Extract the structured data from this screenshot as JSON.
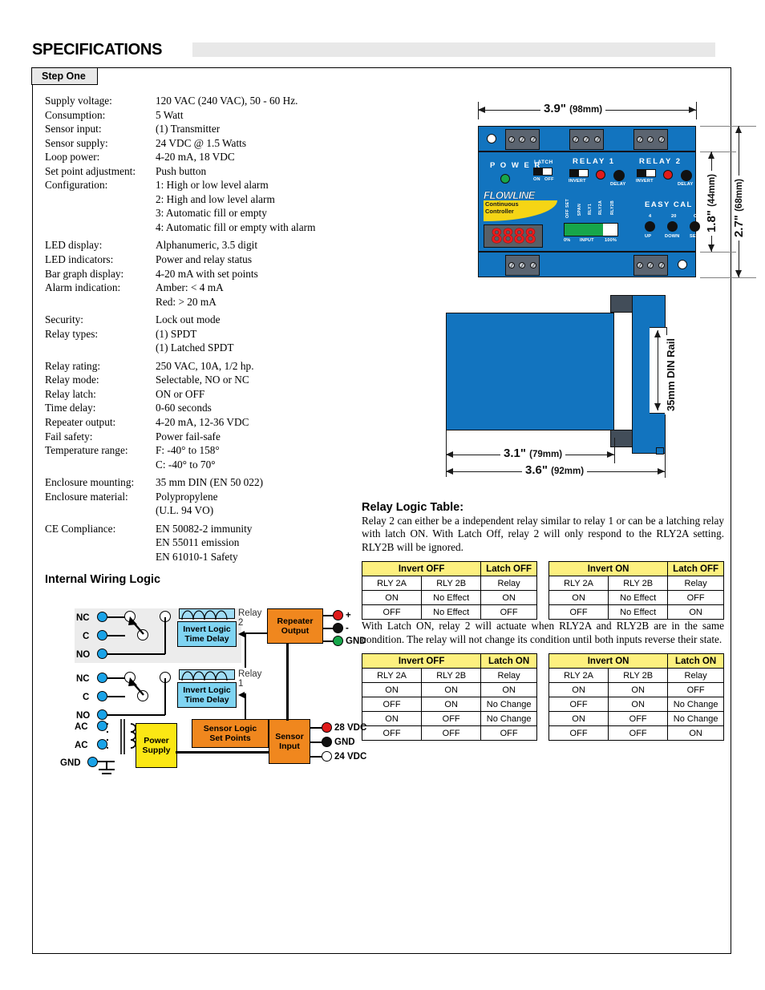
{
  "header": {
    "title": "SPECIFICATIONS",
    "step_badge": "Step One"
  },
  "specifications": [
    {
      "label": "Supply voltage:",
      "value": "120 VAC (240 VAC), 50 - 60 Hz."
    },
    {
      "label": "Consumption:",
      "value": "5 Watt"
    },
    {
      "label": "Sensor input:",
      "value": "(1) Transmitter"
    },
    {
      "label": "Sensor supply:",
      "value": "24 VDC @ 1.5 Watts"
    },
    {
      "label": "Loop power:",
      "value": "4-20 mA, 18 VDC"
    },
    {
      "label": "Set point adjustment:",
      "value": "Push button"
    },
    {
      "label": "Configuration:",
      "value": "1: High or low level alarm"
    },
    {
      "label": "",
      "value": "2: High and low level alarm"
    },
    {
      "label": "",
      "value": "3: Automatic fill or empty"
    },
    {
      "label": "",
      "value": "4: Automatic fill or empty with alarm"
    },
    {
      "label": "LED display:",
      "value": "Alphanumeric, 3.5 digit"
    },
    {
      "label": "LED indicators:",
      "value": "Power and relay status"
    },
    {
      "label": "Bar graph display:",
      "value": "4-20 mA with set points"
    },
    {
      "label": "Alarm indication:",
      "value": "Amber: < 4 mA"
    },
    {
      "label": "",
      "value": "Red: > 20 mA"
    },
    {
      "label": "Security:",
      "value": "Lock out mode"
    },
    {
      "label": "Relay types:",
      "value": "(1) SPDT"
    },
    {
      "label": "",
      "value": "(1) Latched SPDT"
    },
    {
      "label": "Relay rating:",
      "value": "250 VAC, 10A, 1/2 hp."
    },
    {
      "label": "Relay mode:",
      "value": "Selectable, NO or NC"
    },
    {
      "label": "Relay latch:",
      "value": "ON or OFF"
    },
    {
      "label": "Time delay:",
      "value": "0-60 seconds"
    },
    {
      "label": "Repeater output:",
      "value": "4-20 mA, 12-36 VDC"
    },
    {
      "label": "Fail safety:",
      "value": "Power fail-safe"
    },
    {
      "label": "Temperature range:",
      "value": "F: -40° to 158°"
    },
    {
      "label": "",
      "value": "C: -40° to 70°"
    },
    {
      "label": "Enclosure mounting:",
      "value": "35 mm DIN (EN 50 022)"
    },
    {
      "label": "Enclosure material:",
      "value": "Polypropylene"
    },
    {
      "label": "",
      "value": "(U.L. 94 VO)"
    },
    {
      "label": "CE Compliance:",
      "value": "EN 50082-2 immunity"
    },
    {
      "label": "",
      "value": "EN 55011 emission"
    },
    {
      "label": "",
      "value": "EN 61010-1 Safety"
    }
  ],
  "product_drawing": {
    "dimensions": {
      "width_in": "3.9\"",
      "width_mm": "(98mm)",
      "face_height_in": "1.8\"",
      "face_height_mm": "(44mm)",
      "total_height_in": "2.7\"",
      "total_height_mm": "(68mm)",
      "depth_body_in": "3.1\"",
      "depth_body_mm": "(79mm)",
      "depth_total_in": "3.6\"",
      "depth_total_mm": "(92mm)",
      "din_rail": "35mm\nDIN Rail",
      "din_rail_line1": "35mm",
      "din_rail_line2": "DIN Rail"
    },
    "faceplate": {
      "power_label": "P O W E R",
      "latch_label": "LATCH",
      "latch_on": "ON",
      "latch_off": "OFF",
      "relay1_label": "RELAY 1",
      "relay2_label": "RELAY 2",
      "invert_label": "INVERT",
      "delay_label": "DELAY",
      "brand": "FLOWLINE",
      "product_line1": "Continuous",
      "product_line2": "Controller",
      "lcd_value": "8888",
      "bar_ticks": [
        "OFF SET",
        "SPAN",
        "RLY1",
        "RLY2A",
        "RLY2B"
      ],
      "bar_min": "0%",
      "bar_input": "INPUT",
      "bar_max": "100%",
      "easy_cal": "EASY CAL",
      "cal_4": "4",
      "cal_20": "20",
      "cal_op": "OP",
      "cal_up": "UP",
      "cal_down": "DOWN",
      "cal_set": "SET"
    },
    "colors": {
      "enclosure_blue": "#1274bf",
      "power_led_green": "#17a64a",
      "alarm_led_red": "#e01b1b",
      "lcd_red": "#ef1b1b",
      "bargraph_green": "#17a64a",
      "logo_yellow": "#f5d515"
    }
  },
  "wiring_logic": {
    "title": "Internal Wiring Logic",
    "relay2": {
      "name_line1": "Relay",
      "name_line2": "2",
      "terminals": [
        "NC",
        "C",
        "NO"
      ],
      "logic_box_line1": "Invert Logic",
      "logic_box_line2": "Time Delay"
    },
    "relay1": {
      "name_line1": "Relay",
      "name_line2": "1",
      "terminals": [
        "NC",
        "C",
        "NO"
      ],
      "logic_box_line1": "Invert Logic",
      "logic_box_line2": "Time Delay"
    },
    "power": {
      "terminals": [
        "AC",
        "AC",
        "GND"
      ],
      "box_line1": "Power",
      "box_line2": "Supply"
    },
    "sensor_logic": {
      "box_line1": "Sensor Logic",
      "box_line2": "Set Points"
    },
    "sensor_input": {
      "box_line1": "Sensor",
      "box_line2": "Input",
      "outputs": [
        {
          "label": "28 VDC",
          "color": "#e01b1b"
        },
        {
          "label": "GND",
          "color": "#111111"
        },
        {
          "label": "24 VDC",
          "color": "#ffffff"
        }
      ]
    },
    "repeater": {
      "box_line1": "Repeater",
      "box_line2": "Output",
      "outputs": [
        {
          "label": "+",
          "color": "#e01b1b"
        },
        {
          "label": "-",
          "color": "#111111"
        },
        {
          "label": "GND",
          "color": "#17a64a"
        }
      ]
    },
    "colors": {
      "terminal_blue": "#1aa3e8",
      "logic_box_blue": "#7fd4f2",
      "orange_box": "#f0871e",
      "yellow_box": "#fbe714",
      "band_gray": "#ececec"
    }
  },
  "relay_logic_table": {
    "title": "Relay Logic Table:",
    "intro": "Relay 2 can either be a independent relay similar to relay 1 or can be a latching relay with latch ON. With Latch Off, relay 2 will only respond to  the RLY2A setting. RLY2B will be ignored.",
    "mid_text": "With Latch ON, relay 2 will actuate when RLY2A and RLY2B are in the same condition. The relay will not change its condition until both inputs reverse their state.",
    "subheaders": [
      "RLY 2A",
      "RLY 2B",
      "Relay"
    ],
    "tables": [
      {
        "invert": "Invert OFF",
        "latch": "Latch OFF",
        "rows": [
          [
            "ON",
            "No Effect",
            "ON"
          ],
          [
            "OFF",
            "No Effect",
            "OFF"
          ]
        ]
      },
      {
        "invert": "Invert ON",
        "latch": "Latch OFF",
        "rows": [
          [
            "ON",
            "No Effect",
            "OFF"
          ],
          [
            "OFF",
            "No Effect",
            "ON"
          ]
        ]
      },
      {
        "invert": "Invert OFF",
        "latch": "Latch ON",
        "rows": [
          [
            "ON",
            "ON",
            "ON"
          ],
          [
            "OFF",
            "ON",
            "No Change"
          ],
          [
            "ON",
            "OFF",
            "No Change"
          ],
          [
            "OFF",
            "OFF",
            "OFF"
          ]
        ]
      },
      {
        "invert": "Invert ON",
        "latch": "Latch ON",
        "rows": [
          [
            "ON",
            "ON",
            "OFF"
          ],
          [
            "OFF",
            "ON",
            "No Change"
          ],
          [
            "ON",
            "OFF",
            "No Change"
          ],
          [
            "OFF",
            "OFF",
            "ON"
          ]
        ]
      }
    ],
    "colors": {
      "header_yellow": "#fdf07f"
    }
  }
}
